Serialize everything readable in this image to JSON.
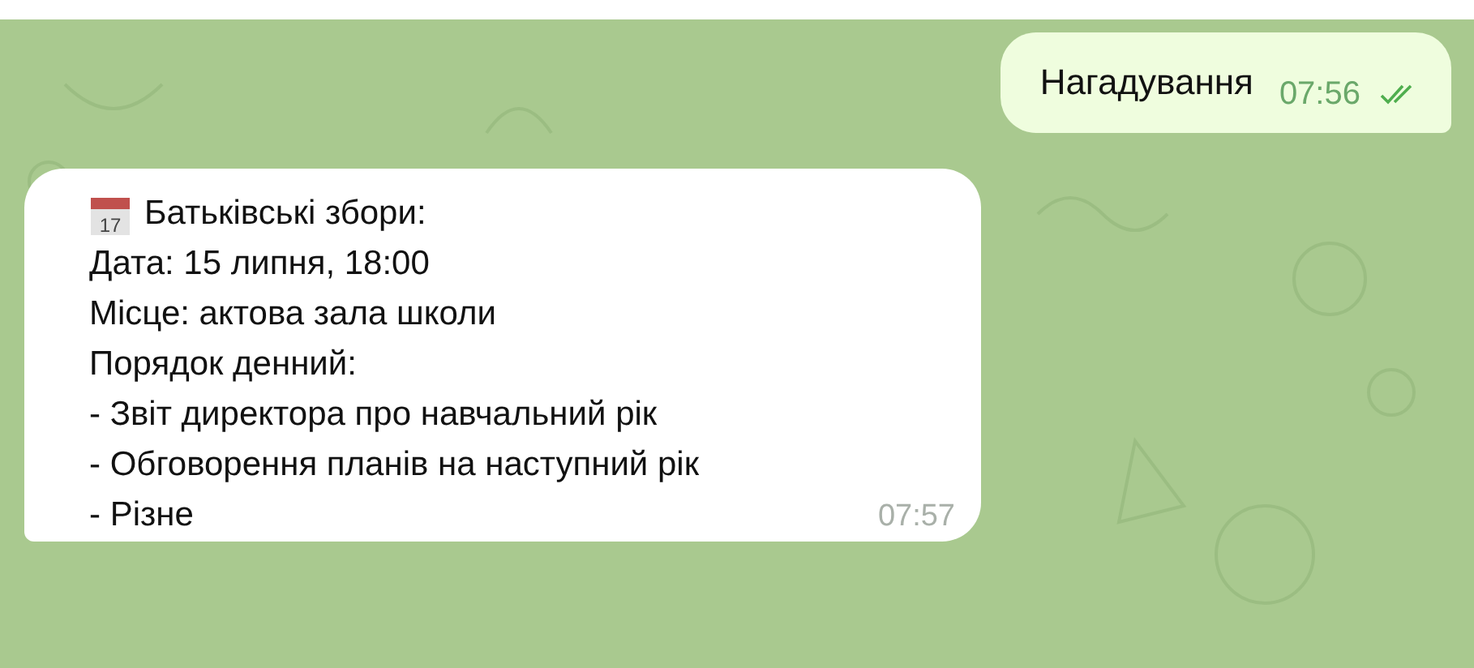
{
  "messages": [
    {
      "kind": "outgoing",
      "lines": [
        "Нагадування"
      ],
      "time": "07:56",
      "read": true
    },
    {
      "kind": "incoming",
      "icon_text": "17",
      "lines": [
        "Батьківські збори:",
        "Дата: 15 липня, 18:00",
        "Місце: актова зала школи",
        "Порядок денний:",
        "- Звіт директора про навчальний рік",
        "- Обговорення планів на наступний рік",
        "- Різне"
      ],
      "time": "07:57"
    }
  ]
}
